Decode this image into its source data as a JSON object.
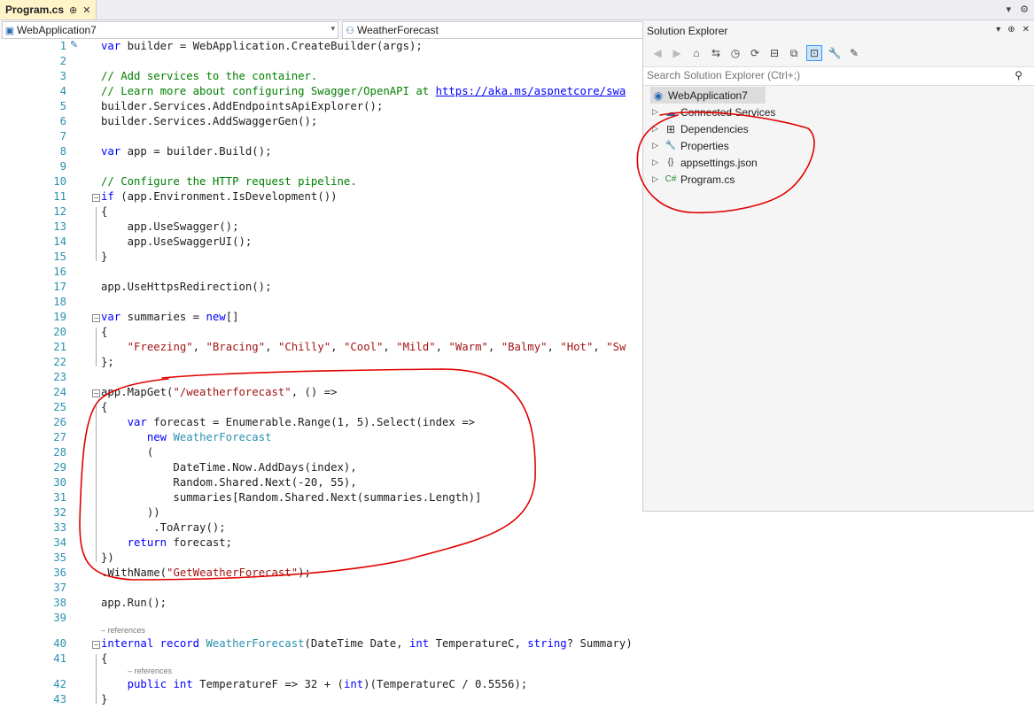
{
  "tab": {
    "title": "Program.cs",
    "pin": "⊕",
    "close": "✕",
    "menu": "▾",
    "settings": "⚙"
  },
  "nav": {
    "project": "WebApplication7",
    "member": "WeatherForecast"
  },
  "editor": {
    "references_label": "– references",
    "lines": [
      {
        "n": "1",
        "tokens": [
          [
            "kw",
            "var"
          ],
          [
            "p",
            " builder = WebApplication.CreateBuilder(args);"
          ]
        ]
      },
      {
        "n": "2",
        "tokens": []
      },
      {
        "n": "3",
        "tokens": [
          [
            "cm",
            "// Add services to the container."
          ]
        ]
      },
      {
        "n": "4",
        "tokens": [
          [
            "cm",
            "// Learn more about configuring Swagger/OpenAPI at "
          ],
          [
            "lnk",
            "https://aka.ms/aspnetcore/swa"
          ]
        ]
      },
      {
        "n": "5",
        "tokens": [
          [
            "p",
            "builder.Services.AddEndpointsApiExplorer();"
          ]
        ]
      },
      {
        "n": "6",
        "tokens": [
          [
            "p",
            "builder.Services.AddSwaggerGen();"
          ]
        ]
      },
      {
        "n": "7",
        "tokens": []
      },
      {
        "n": "8",
        "tokens": [
          [
            "kw",
            "var"
          ],
          [
            "p",
            " app = builder.Build();"
          ]
        ]
      },
      {
        "n": "9",
        "tokens": []
      },
      {
        "n": "10",
        "tokens": [
          [
            "cm",
            "// Configure the HTTP request pipeline."
          ]
        ]
      },
      {
        "n": "11",
        "tokens": [
          [
            "kw",
            "if"
          ],
          [
            "p",
            " (app.Environment.IsDevelopment())"
          ]
        ]
      },
      {
        "n": "12",
        "tokens": [
          [
            "p",
            "{"
          ]
        ]
      },
      {
        "n": "13",
        "tokens": [
          [
            "p",
            "    app.UseSwagger();"
          ]
        ]
      },
      {
        "n": "14",
        "tokens": [
          [
            "p",
            "    app.UseSwaggerUI();"
          ]
        ]
      },
      {
        "n": "15",
        "tokens": [
          [
            "p",
            "}"
          ]
        ]
      },
      {
        "n": "16",
        "tokens": []
      },
      {
        "n": "17",
        "tokens": [
          [
            "p",
            "app.UseHttpsRedirection();"
          ]
        ]
      },
      {
        "n": "18",
        "tokens": []
      },
      {
        "n": "19",
        "tokens": [
          [
            "kw",
            "var"
          ],
          [
            "p",
            " summaries = "
          ],
          [
            "kw",
            "new"
          ],
          [
            "p",
            "[]"
          ]
        ]
      },
      {
        "n": "20",
        "tokens": [
          [
            "p",
            "{"
          ]
        ]
      },
      {
        "n": "21",
        "tokens": [
          [
            "p",
            "    "
          ],
          [
            "st",
            "\"Freezing\""
          ],
          [
            "p",
            ", "
          ],
          [
            "st",
            "\"Bracing\""
          ],
          [
            "p",
            ", "
          ],
          [
            "st",
            "\"Chilly\""
          ],
          [
            "p",
            ", "
          ],
          [
            "st",
            "\"Cool\""
          ],
          [
            "p",
            ", "
          ],
          [
            "st",
            "\"Mild\""
          ],
          [
            "p",
            ", "
          ],
          [
            "st",
            "\"Warm\""
          ],
          [
            "p",
            ", "
          ],
          [
            "st",
            "\"Balmy\""
          ],
          [
            "p",
            ", "
          ],
          [
            "st",
            "\"Hot\""
          ],
          [
            "p",
            ", "
          ],
          [
            "st",
            "\"Sw"
          ]
        ]
      },
      {
        "n": "22",
        "tokens": [
          [
            "p",
            "};"
          ]
        ]
      },
      {
        "n": "23",
        "tokens": []
      },
      {
        "n": "24",
        "tokens": [
          [
            "p",
            "app.MapGet("
          ],
          [
            "st",
            "\"/weatherforecast\""
          ],
          [
            "p",
            ", () =>"
          ]
        ]
      },
      {
        "n": "25",
        "tokens": [
          [
            "p",
            "{"
          ]
        ]
      },
      {
        "n": "26",
        "tokens": [
          [
            "p",
            "    "
          ],
          [
            "kw",
            "var"
          ],
          [
            "p",
            " forecast = Enumerable.Range(1, 5).Select(index =>"
          ]
        ]
      },
      {
        "n": "27",
        "tokens": [
          [
            "p",
            "       "
          ],
          [
            "kw",
            "new"
          ],
          [
            "p",
            " "
          ],
          [
            "ty",
            "WeatherForecast"
          ]
        ]
      },
      {
        "n": "28",
        "tokens": [
          [
            "p",
            "       ("
          ]
        ]
      },
      {
        "n": "29",
        "tokens": [
          [
            "p",
            "           DateTime.Now.AddDays(index),"
          ]
        ]
      },
      {
        "n": "30",
        "tokens": [
          [
            "p",
            "           Random.Shared.Next(-20, 55),"
          ]
        ]
      },
      {
        "n": "31",
        "tokens": [
          [
            "p",
            "           summaries[Random.Shared.Next(summaries.Length)]"
          ]
        ]
      },
      {
        "n": "32",
        "tokens": [
          [
            "p",
            "       ))"
          ]
        ]
      },
      {
        "n": "33",
        "tokens": [
          [
            "p",
            "        .ToArray();"
          ]
        ]
      },
      {
        "n": "34",
        "tokens": [
          [
            "p",
            "    "
          ],
          [
            "kw",
            "return"
          ],
          [
            "p",
            " forecast;"
          ]
        ]
      },
      {
        "n": "35",
        "tokens": [
          [
            "p",
            "})"
          ]
        ]
      },
      {
        "n": "36",
        "tokens": [
          [
            "p",
            ".WithName("
          ],
          [
            "st",
            "\"GetWeatherForecast\""
          ],
          [
            "p",
            ");"
          ]
        ]
      },
      {
        "n": "37",
        "tokens": []
      },
      {
        "n": "38",
        "tokens": [
          [
            "p",
            "app.Run();"
          ]
        ]
      },
      {
        "n": "39",
        "tokens": []
      },
      {
        "n": "40",
        "tokens": [
          [
            "kw",
            "internal"
          ],
          [
            "p",
            " "
          ],
          [
            "kw",
            "record"
          ],
          [
            "p",
            " "
          ],
          [
            "ty",
            "WeatherForecast"
          ],
          [
            "p",
            "(DateTime Date, "
          ],
          [
            "kw",
            "int"
          ],
          [
            "p",
            " TemperatureC, "
          ],
          [
            "kw",
            "string"
          ],
          [
            "p",
            "? Summary)"
          ]
        ]
      },
      {
        "n": "41",
        "tokens": [
          [
            "p",
            "{"
          ]
        ]
      },
      {
        "n": "42",
        "tokens": [
          [
            "p",
            "    "
          ],
          [
            "kw",
            "public"
          ],
          [
            "p",
            " "
          ],
          [
            "kw",
            "int"
          ],
          [
            "p",
            " TemperatureF => 32 + ("
          ],
          [
            "kw",
            "int"
          ],
          [
            "p",
            ")(TemperatureC / 0.5556);"
          ]
        ]
      },
      {
        "n": "43",
        "tokens": [
          [
            "p",
            "}"
          ]
        ]
      }
    ]
  },
  "solution_explorer": {
    "title": "Solution Explorer",
    "search_placeholder": "Search Solution Explorer (Ctrl+;)",
    "root": "WebApplication7",
    "items": [
      {
        "label": "Connected Services",
        "icon": "connected-services-icon",
        "glyph": "☁"
      },
      {
        "label": "Dependencies",
        "icon": "dependencies-icon",
        "glyph": "⊞"
      },
      {
        "label": "Properties",
        "icon": "properties-icon",
        "glyph": "🔧"
      },
      {
        "label": "appsettings.json",
        "icon": "json-file-icon",
        "glyph": "{}"
      },
      {
        "label": "Program.cs",
        "icon": "csharp-file-icon",
        "glyph": "C#"
      }
    ]
  },
  "colors": {
    "keyword": "#0000ff",
    "type": "#2b91af",
    "comment": "#008000",
    "string": "#a31515",
    "annotation": "#e00000"
  }
}
